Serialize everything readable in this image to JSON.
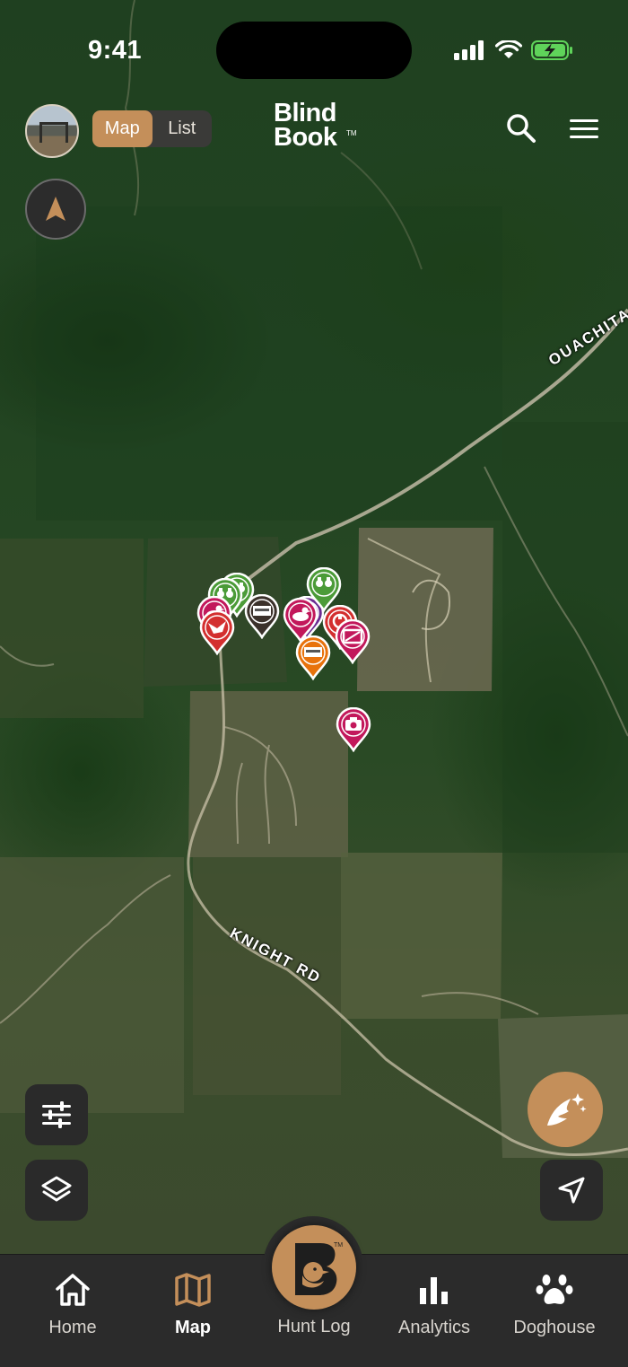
{
  "status_bar": {
    "time": "9:41"
  },
  "header": {
    "view_toggle": {
      "options": [
        "Map",
        "List"
      ],
      "selected": "Map"
    },
    "logo": {
      "line1": "Blind",
      "line2": "Book",
      "tm": "TM"
    }
  },
  "map": {
    "road_labels": [
      "OUACHITA",
      "KNIGHT RD"
    ],
    "pins": [
      {
        "color": "#4b9b38",
        "icon": "binoculars-icon"
      },
      {
        "color": "#4b9b38",
        "icon": "binoculars-icon"
      },
      {
        "color": "#c2185b",
        "icon": "duck-icon"
      },
      {
        "color": "#d32f2f",
        "icon": "duck-flying-icon"
      },
      {
        "color": "#3b312b",
        "icon": "blind-icon"
      },
      {
        "color": "#6a2c91",
        "icon": "duck-icon"
      },
      {
        "color": "#c2185b",
        "icon": "duck-icon"
      },
      {
        "color": "#4b9b38",
        "icon": "binoculars-icon"
      },
      {
        "color": "#d32f2f",
        "icon": "feeder-icon"
      },
      {
        "color": "#c2185b",
        "icon": "trailcam-icon"
      },
      {
        "color": "#e8720c",
        "icon": "blind-icon"
      },
      {
        "color": "#c2185b",
        "icon": "camera-icon"
      }
    ]
  },
  "bottom_nav": {
    "items": [
      {
        "label": "Home",
        "icon": "home-icon"
      },
      {
        "label": "Map",
        "icon": "map-icon"
      },
      {
        "label": "Hunt Log",
        "icon": "blindbook-duck-icon"
      },
      {
        "label": "Analytics",
        "icon": "bar-chart-icon"
      },
      {
        "label": "Doghouse",
        "icon": "paw-icon"
      }
    ],
    "selected": "Map"
  },
  "colors": {
    "accent": "#c48f5a",
    "nav_bg": "#2b2b2b"
  }
}
